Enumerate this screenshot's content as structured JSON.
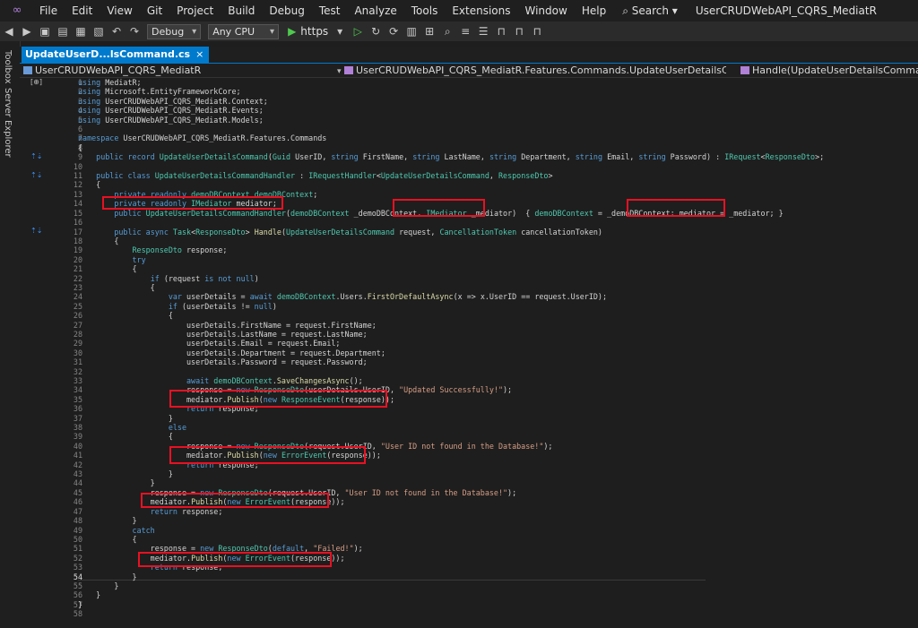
{
  "menubar": {
    "items": [
      "File",
      "Edit",
      "View",
      "Git",
      "Project",
      "Build",
      "Debug",
      "Test",
      "Analyze",
      "Tools",
      "Extensions",
      "Window",
      "Help"
    ],
    "search_label": "Search",
    "solution_title": "UserCRUDWebAPI_CQRS_MediatR"
  },
  "toolbar": {
    "config": "Debug",
    "platform": "Any CPU",
    "run_target": "https"
  },
  "side_tabs": [
    "Toolbox",
    "Server Explorer"
  ],
  "tab": {
    "label": "UpdateUserD...lsCommand.cs"
  },
  "navbar": {
    "project": "UserCRUDWebAPI_CQRS_MediatR",
    "type": "UserCRUDWebAPI_CQRS_MediatR.Features.Commands.UpdateUserDetailsCommandHandler",
    "member": "Handle(UpdateUserDetailsCommand request,"
  },
  "editor": {
    "current_line": 54,
    "lines": [
      "using MediatR;",
      "using Microsoft.EntityFrameworkCore;",
      "using UserCRUDWebAPI_CQRS_MediatR.Context;",
      "using UserCRUDWebAPI_CQRS_MediatR.Events;",
      "using UserCRUDWebAPI_CQRS_MediatR.Models;",
      "",
      "namespace UserCRUDWebAPI_CQRS_MediatR.Features.Commands",
      "{",
      "    public record UpdateUserDetailsCommand(Guid UserID, string FirstName, string LastName, string Department, string Email, string Password) : IRequest<ResponseDto>;",
      "",
      "    public class UpdateUserDetailsCommandHandler : IRequestHandler<UpdateUserDetailsCommand, ResponseDto>",
      "    {",
      "        private readonly demoDBContext demoDBContext;",
      "        private readonly IMediator mediator;",
      "        public UpdateUserDetailsCommandHandler(demoDBContext _demoDBContext, IMediator _mediator)  { demoDBContext = _demoDBContext; mediator = _mediator; }",
      "",
      "        public async Task<ResponseDto> Handle(UpdateUserDetailsCommand request, CancellationToken cancellationToken)",
      "        {",
      "            ResponseDto response;",
      "            try",
      "            {",
      "                if (request is not null)",
      "                {",
      "                    var userDetails = await demoDBContext.Users.FirstOrDefaultAsync(x => x.UserID == request.UserID);",
      "                    if (userDetails != null)",
      "                    {",
      "                        userDetails.FirstName = request.FirstName;",
      "                        userDetails.LastName = request.LastName;",
      "                        userDetails.Email = request.Email;",
      "                        userDetails.Department = request.Department;",
      "                        userDetails.Password = request.Password;",
      "",
      "                        await demoDBContext.SaveChangesAsync();",
      "                        response = new ResponseDto(userDetails.UserID, \"Updated Successfully!\");",
      "                        mediator.Publish(new ResponseEvent(response));",
      "                        return response;",
      "                    }",
      "                    else",
      "                    {",
      "                        response = new ResponseDto(request.UserID, \"User ID not found in the Database!\");",
      "                        mediator.Publish(new ErrorEvent(response));",
      "                        return response;",
      "                    }",
      "                }",
      "                response = new ResponseDto(request.UserID, \"User ID not found in the Database!\");",
      "                mediator.Publish(new ErrorEvent(response));",
      "                return response;",
      "            }",
      "            catch",
      "            {",
      "                response = new ResponseDto(default, \"Failed!\");",
      "                mediator.Publish(new ErrorEvent(response));",
      "                return response;",
      "            }",
      "        }",
      "    }",
      "}",
      ""
    ]
  },
  "colors": {
    "accent": "#007acc",
    "highlight_box": "#e81123",
    "keyword": "#569cd6",
    "type": "#4ec9b0",
    "string": "#d69d85",
    "method": "#dcdcaa"
  }
}
